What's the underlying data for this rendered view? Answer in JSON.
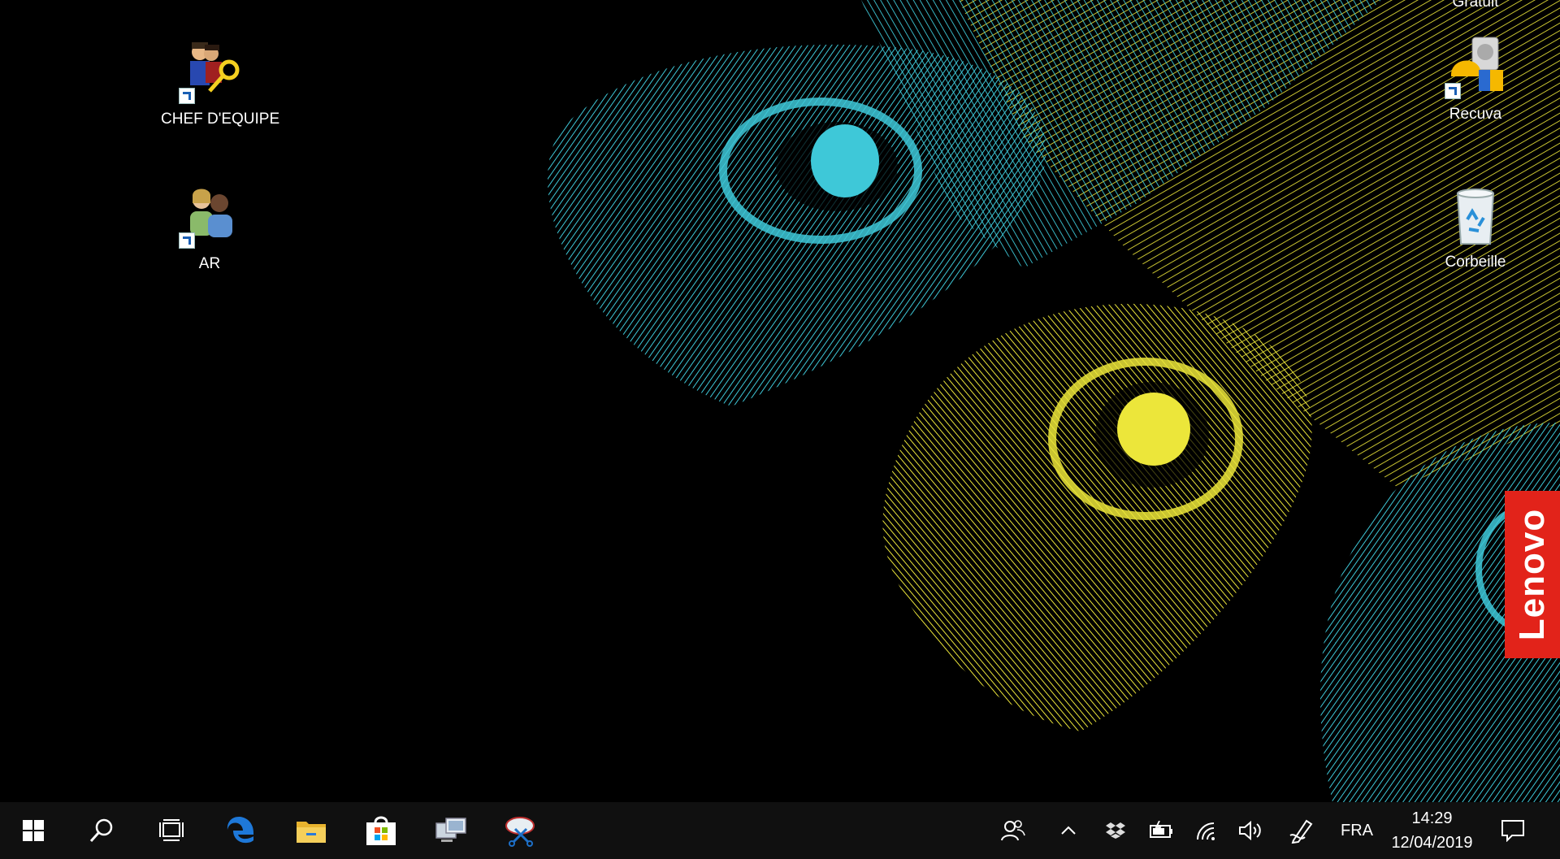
{
  "desktop": {
    "icons_left": [
      {
        "label": "CHEF D'EQUIPE",
        "icon": "key-people-icon"
      },
      {
        "label": "AR",
        "icon": "two-people-icon"
      }
    ],
    "icons_right": [
      {
        "label": "Gratuit",
        "icon": "partial-hidden-label"
      },
      {
        "label": "Recuva",
        "icon": "recuva-icon"
      },
      {
        "label": "Corbeille",
        "icon": "recycle-bin-icon"
      }
    ],
    "brand_tab": "Lenovo",
    "wallpaper_colors": {
      "cyan": "#3ec8d8",
      "yellow": "#ece63a",
      "background": "#000000"
    }
  },
  "taskbar": {
    "pinned": [
      {
        "name": "start",
        "icon": "windows-logo-icon"
      },
      {
        "name": "search",
        "icon": "search-icon"
      },
      {
        "name": "task-view",
        "icon": "task-view-icon"
      },
      {
        "name": "edge",
        "icon": "edge-icon"
      },
      {
        "name": "file-explorer",
        "icon": "folder-icon"
      },
      {
        "name": "store",
        "icon": "store-icon"
      },
      {
        "name": "remote-desktop",
        "icon": "remote-desktop-icon"
      },
      {
        "name": "snipping-tool",
        "icon": "snipping-tool-icon"
      }
    ],
    "tray": {
      "language": "FRA",
      "time": "14:29",
      "date": "12/04/2019",
      "icons": [
        "people-icon",
        "chevron-up-icon",
        "dropbox-icon",
        "battery-icon",
        "wifi-icon",
        "volume-icon",
        "pen-icon",
        "notifications-icon"
      ]
    },
    "background_color": "#101010"
  }
}
